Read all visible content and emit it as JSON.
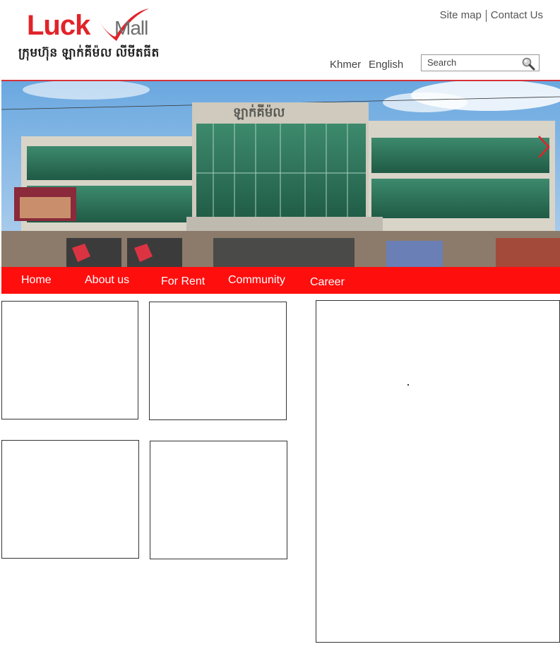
{
  "brand": {
    "logo_lucky": "Luck",
    "logo_mall": "Mall",
    "khmer_name": "ក្រុមហ៊ុន ឡាក់គីម៉ល លីមីតធីត",
    "logo_color": "#e1232a"
  },
  "top_links": {
    "site_map": "Site map",
    "contact_us": "Contact Us"
  },
  "language": {
    "khmer": "Khmer",
    "english": "English"
  },
  "search": {
    "placeholder": "Search",
    "icon": "search-icon"
  },
  "banner": {
    "sign_text": "ឡាក់គីម៉ល",
    "next_icon": "chevron-right-icon",
    "accent": "#d73237"
  },
  "nav": {
    "color": "#ff0e0e",
    "items": [
      {
        "label": "Home"
      },
      {
        "label": "About us"
      },
      {
        "label": "For Rent"
      },
      {
        "label": "Community"
      },
      {
        "label": "Career"
      }
    ]
  }
}
